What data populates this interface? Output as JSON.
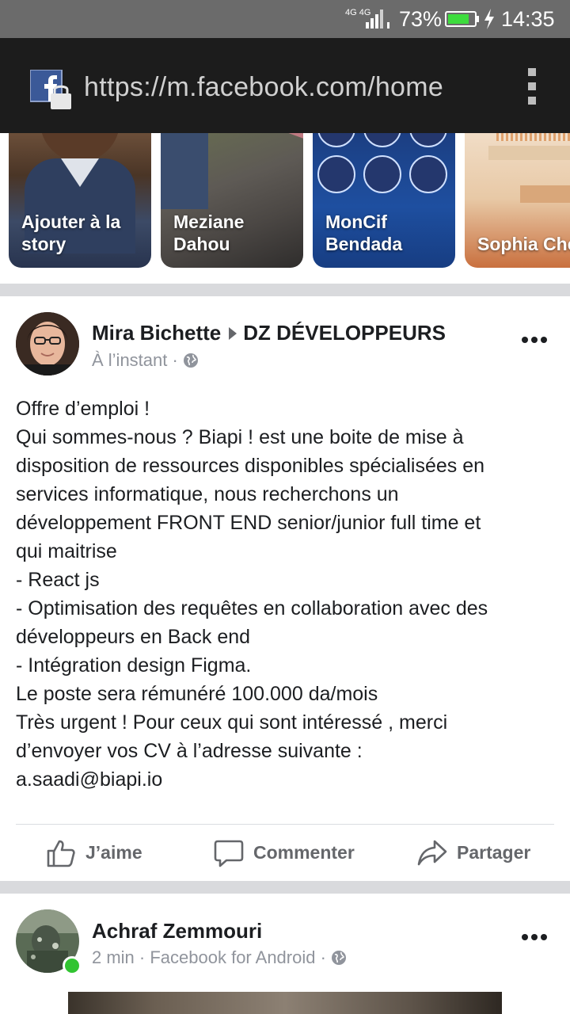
{
  "status_bar": {
    "network": "4G 4G",
    "battery_percent": "73%",
    "time": "14:35"
  },
  "browser": {
    "url": "https://m.facebook.com/home",
    "site_icon": "facebook-lock-icon",
    "menu_icon": "more-vertical-icon"
  },
  "stories": [
    {
      "label": "Ajouter à la story"
    },
    {
      "label": "Meziane Dahou"
    },
    {
      "label": "MonCif Bendada"
    },
    {
      "label": "Sophia Chen"
    }
  ],
  "post1": {
    "author": "Mira Bichette",
    "group": "DZ DÉVELOPPEURS",
    "time": "À l’instant ·",
    "lines": [
      "Offre d’emploi !",
      "Qui sommes-nous ? Biapi ! est une boite de mise à",
      "disposition de ressources disponibles spécialisées en",
      "services informatique, nous recherchons un",
      "développement FRONT END senior/junior full time et",
      "qui maitrise",
      "- React js",
      "- Optimisation des requêtes en collaboration avec des",
      "développeurs en Back end",
      "- Intégration design Figma.",
      "Le poste sera rémunéré 100.000 da/mois",
      "Très urgent ! Pour ceux qui sont intéressé , merci",
      "d’envoyer vos CV à l’adresse suivante :",
      "a.saadi@biapi.io"
    ],
    "actions": {
      "like": "J’aime",
      "comment": "Commenter",
      "share": "Partager"
    }
  },
  "post2": {
    "author": "Achraf Zemmouri",
    "time": "2 min · Facebook for Android ·"
  },
  "colors": {
    "status_bar": "#6b6b6b",
    "url_bar": "#1c1c1c",
    "facebook_blue": "#3b5998",
    "text": "#1c1e21",
    "muted": "#90949c",
    "online": "#31c431"
  }
}
